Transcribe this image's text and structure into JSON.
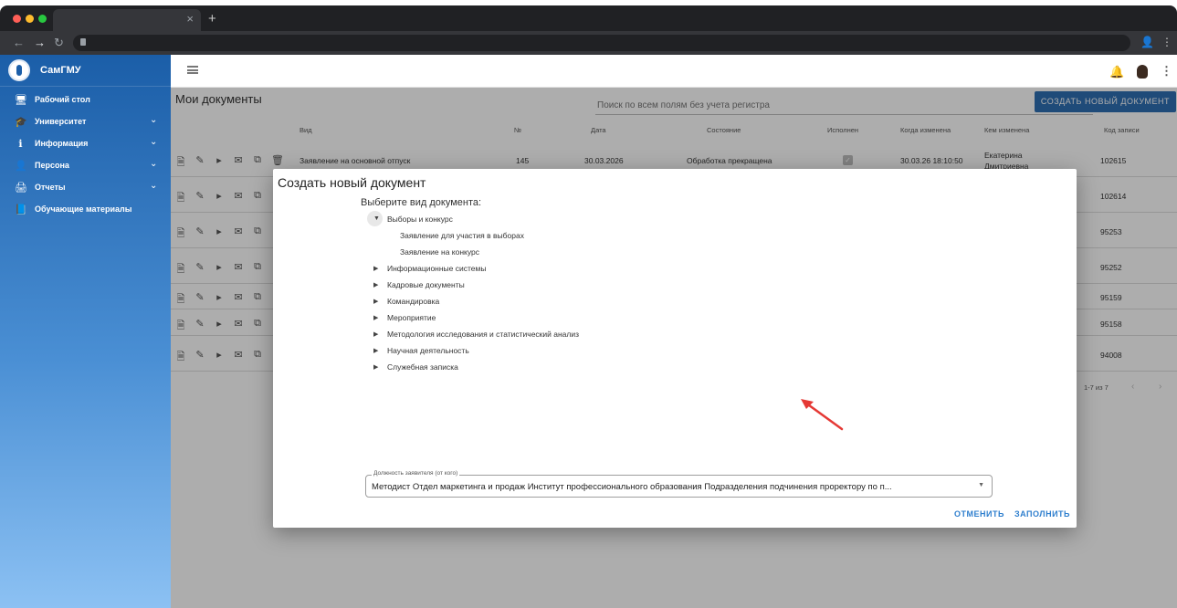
{
  "browser": {
    "traffic_lights": [
      "#ff5f57",
      "#febc2e",
      "#28c840"
    ],
    "tab_close": "×",
    "new_tab": "+"
  },
  "sidebar": {
    "brand": "СамГМУ",
    "items": [
      {
        "label": "Рабочий стол",
        "icon": "desktop-icon",
        "glyph": "🖥",
        "expandable": false
      },
      {
        "label": "Университет",
        "icon": "graduation-cap-icon",
        "glyph": "🎓",
        "expandable": true
      },
      {
        "label": "Информация",
        "icon": "info-icon",
        "glyph": "ℹ",
        "expandable": true
      },
      {
        "label": "Персона",
        "icon": "person-icon",
        "glyph": "👤",
        "expandable": true
      },
      {
        "label": "Отчеты",
        "icon": "printer-icon",
        "glyph": "🖨",
        "expandable": true
      },
      {
        "label": "Обучающие материалы",
        "icon": "training-icon",
        "glyph": "📘",
        "expandable": false
      }
    ]
  },
  "main": {
    "title": "Мои документы",
    "search_placeholder": "Поиск по всем полям без учета регистра",
    "create_button": "СОЗДАТЬ НОВЫЙ ДОКУМЕНТ",
    "columns": [
      "Вид",
      "№",
      "Дата",
      "Состояние",
      "Исполнен",
      "Когда изменена",
      "Кем изменена",
      "Код записи"
    ],
    "rows": [
      {
        "kind": "Заявление на основной отпуск",
        "num": "145",
        "date": "30.03.2026",
        "state": "Обработка прекращена",
        "done": true,
        "changed": "30.03.26 18:10:50",
        "by1": "Екатерина",
        "by2": "Дмитриевна",
        "code": "102615"
      },
      {
        "kind": "",
        "num": "",
        "date": "",
        "state": "",
        "done": false,
        "changed": "",
        "by1": "",
        "by2": "",
        "code": "102614"
      },
      {
        "kind": "",
        "num": "",
        "date": "",
        "state": "",
        "done": false,
        "changed": "",
        "by1": "",
        "by2": "",
        "code": "95253"
      },
      {
        "kind": "",
        "num": "",
        "date": "",
        "state": "",
        "done": false,
        "changed": "",
        "by1": "",
        "by2": "",
        "code": "95252"
      },
      {
        "kind": "",
        "num": "",
        "date": "",
        "state": "",
        "done": false,
        "changed": "",
        "by1": "",
        "by2": "",
        "code": "95159"
      },
      {
        "kind": "",
        "num": "",
        "date": "",
        "state": "",
        "done": false,
        "changed": "",
        "by1": "",
        "by2": "",
        "code": "95158"
      },
      {
        "kind": "",
        "num": "",
        "date": "",
        "state": "",
        "done": false,
        "changed": "",
        "by1": "",
        "by2": "",
        "code": "94008"
      }
    ],
    "pager": "1-7 из 7"
  },
  "dialog": {
    "title": "Создать новый документ",
    "subtitle": "Выберите вид документа:",
    "tree": [
      {
        "label": "Выборы и конкурс",
        "expanded": true,
        "children": [
          "Заявление для участия в выборах",
          "Заявление на конкурс"
        ]
      },
      {
        "label": "Информационные системы",
        "expanded": false
      },
      {
        "label": "Кадровые документы",
        "expanded": false
      },
      {
        "label": "Командировка",
        "expanded": false
      },
      {
        "label": "Мероприятие",
        "expanded": false
      },
      {
        "label": "Методология исследования и статистический анализ",
        "expanded": false
      },
      {
        "label": "Научная деятельность",
        "expanded": false
      },
      {
        "label": "Служебная записка",
        "expanded": false
      }
    ],
    "field_label": "Должность заявителя (от кого)",
    "field_value": "Методист Отдел маркетинга и продаж Институт профессионального образования Подразделения подчинения проректору по п...",
    "cancel": "ОТМЕНИТЬ",
    "submit": "ЗАПОЛНИТЬ",
    "accent": "#2f7fce",
    "annotation_color": "#e53935"
  }
}
